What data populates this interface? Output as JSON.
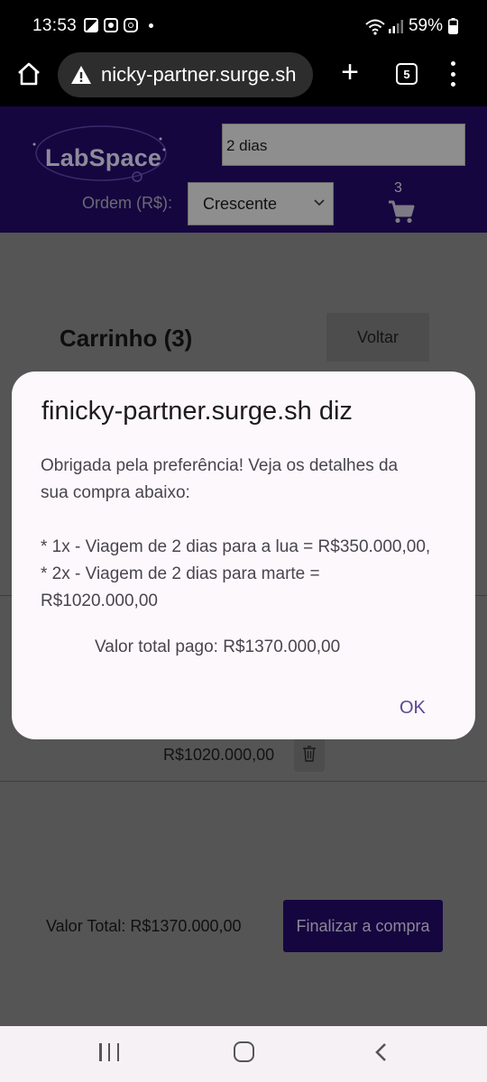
{
  "status_bar": {
    "time": "13:53",
    "battery": "59%"
  },
  "browser": {
    "url": "nicky-partner.surge.sh",
    "tab_count": "5",
    "new_tab_label": "+"
  },
  "site": {
    "logo_text": "LabSpace",
    "search_value": "2 dias",
    "order_label": "Ordem (R$):",
    "order_value": "Crescente",
    "cart_count": "3"
  },
  "page": {
    "cart_title": "Carrinho (3)",
    "back_label": "Voltar",
    "item_price": "R$1020.000,00",
    "total_label": "Valor Total: R$1370.000,00",
    "finish_label": "Finalizar a compra"
  },
  "dialog": {
    "title": "finicky-partner.surge.sh diz",
    "line1": "Obrigada pela preferência! Veja os detalhes da",
    "line2": "sua compra abaixo:",
    "line3": "* 1x - Viagem de 2 dias para a lua = R$350.000,00,",
    "line4": "* 2x - Viagem de 2 dias para marte =",
    "line5": "R$1020.000,00",
    "total": "Valor total pago: R$1370.000,00",
    "ok_label": "OK"
  },
  "colors": {
    "overlay_bg": "#555555",
    "header_bg": "#150640",
    "dialog_bg": "#fdf8fb",
    "accent": "#5b4894"
  }
}
